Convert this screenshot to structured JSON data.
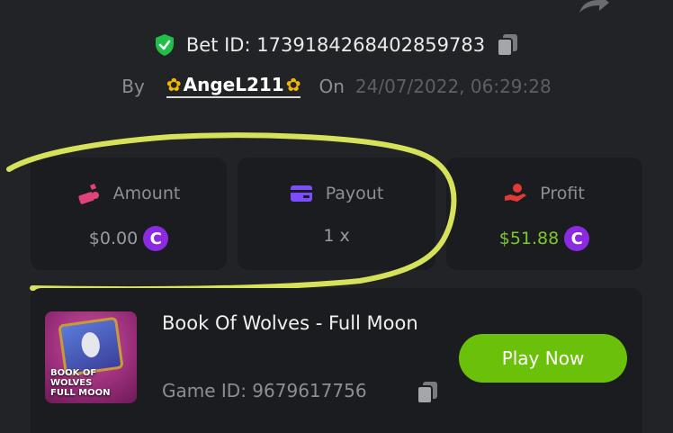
{
  "header": {
    "bet_label": "Bet ID:",
    "bet_id": "1739184268402859783",
    "by_label": "By",
    "username": "AngeL211",
    "on_label": "On",
    "datetime": "24/07/2022, 06:29:28"
  },
  "stats": {
    "amount": {
      "label": "Amount",
      "value": "$0.00"
    },
    "payout": {
      "label": "Payout",
      "value": "1 x"
    },
    "profit": {
      "label": "Profit",
      "value": "$51.88"
    }
  },
  "coin_symbol": "C",
  "game": {
    "title": "Book Of Wolves - Full Moon",
    "id_label": "Game ID:",
    "id": "9679617756",
    "thumb_text_1": "BOOK OF WOLVES",
    "thumb_text_2": "FULL MOON",
    "play_label": "Play Now"
  },
  "colors": {
    "background": "#222327",
    "card": "#1b1c1f",
    "accent_green": "#6bc10a",
    "profit_green": "#7dc630",
    "coin_purple": "#8a2be2",
    "amount_icon": "#e0437a",
    "payout_icon": "#7c4dff",
    "profit_icon": "#e53935",
    "highlight": "#d6e25a"
  },
  "icons": [
    "share-icon",
    "verified-shield-icon",
    "copy-icon",
    "sunflower-icon",
    "money-bag-icon",
    "wallet-icon",
    "hand-coin-icon",
    "coin-icon"
  ]
}
